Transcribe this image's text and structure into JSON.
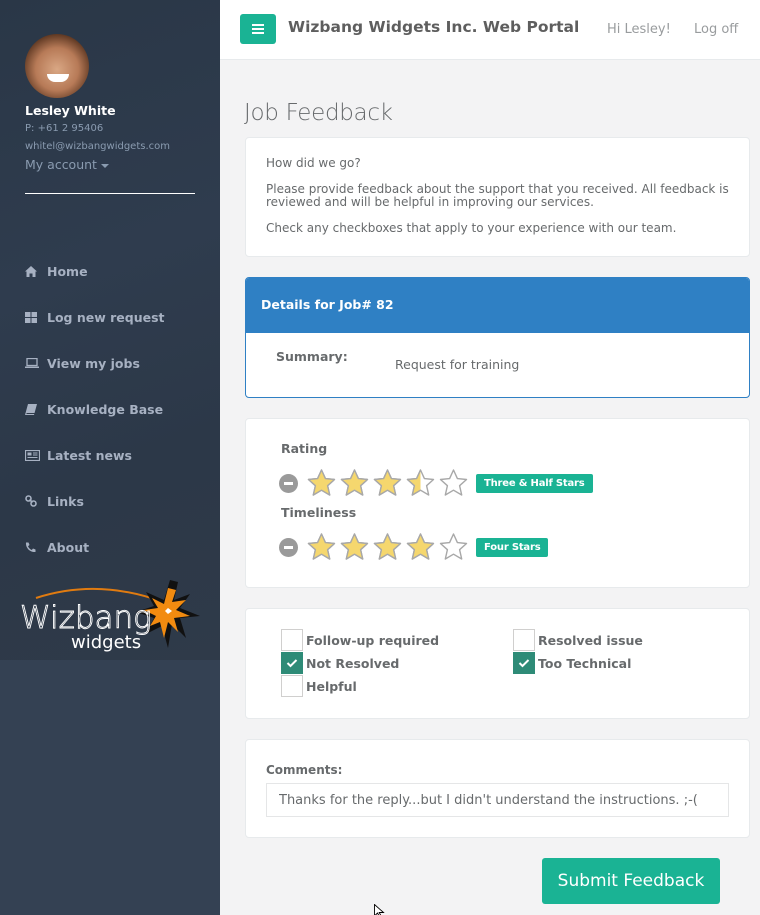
{
  "app": {
    "title": "Wizbang Widgets Inc. Web Portal",
    "greeting": "Hi Lesley!",
    "logoff_label": "Log off",
    "menu_icon": "hamburger-icon",
    "accent_color": "#1ab394",
    "panel_color": "#2f80c4"
  },
  "user": {
    "name": "Lesley White",
    "phone": "P: +61 2 95406",
    "email": "whitel@wizbangwidgets.com",
    "account_label": "My account"
  },
  "sidebar": {
    "items": [
      {
        "label": "Home",
        "icon": "home-icon"
      },
      {
        "label": "Log new request",
        "icon": "grid-icon"
      },
      {
        "label": "View my jobs",
        "icon": "laptop-icon"
      },
      {
        "label": "Knowledge Base",
        "icon": "book-icon"
      },
      {
        "label": "Latest news",
        "icon": "newspaper-icon"
      },
      {
        "label": "Links",
        "icon": "link-icon"
      },
      {
        "label": "About",
        "icon": "phone-icon"
      }
    ],
    "logo": {
      "line1": "Wizbang",
      "line2": "widgets"
    }
  },
  "page": {
    "title": "Job Feedback",
    "intro": [
      "How did we go?",
      "Please provide feedback about the support that you received. All feedback is reviewed and will be helpful in improving our services.",
      "Check any checkboxes that apply to your experience with our team."
    ],
    "details": {
      "heading": "Details for Job# 82",
      "summary_label": "Summary:",
      "summary_value": "Request for training"
    },
    "ratings": [
      {
        "label": "Rating",
        "value": 3.5,
        "max": 5,
        "badge": "Three & Half Stars"
      },
      {
        "label": "Timeliness",
        "value": 4,
        "max": 5,
        "badge": "Four Stars"
      }
    ],
    "checkboxes": [
      {
        "label": "Follow-up required",
        "checked": false
      },
      {
        "label": "Resolved issue",
        "checked": false
      },
      {
        "label": "Not Resolved",
        "checked": true
      },
      {
        "label": "Too Technical",
        "checked": true
      },
      {
        "label": "Helpful",
        "checked": false
      }
    ],
    "comments": {
      "label": "Comments:",
      "value": "Thanks for the reply...but I didn't understand the instructions. ;-("
    },
    "submit_label": "Submit Feedback"
  }
}
